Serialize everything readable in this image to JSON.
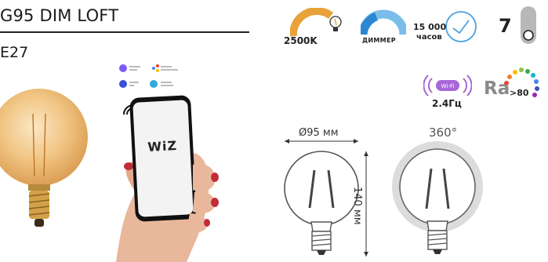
{
  "header": {
    "title": "G95 DIM LOFT",
    "socket": "E27"
  },
  "specs": {
    "color_temp": "2500K",
    "dimmer": "ДИММЕР",
    "lifetime_value": "15 000",
    "lifetime_unit": "часов",
    "warranty_years": "7",
    "wifi_badge": "Wi-Fi",
    "wifi_freq": "2.4Гц",
    "cri_symbol": "Ra",
    "cri_value": ">80"
  },
  "dimensions": {
    "width": "Ø95 мм",
    "height": "140 мм",
    "angle": "360°"
  },
  "phone": {
    "app_name": "WiZ"
  },
  "colors": {
    "amber": "#e8a23a",
    "accent_blue": "#4aa3e0",
    "wifi_purple": "#a867d6",
    "dark": "#1a1a1a"
  }
}
